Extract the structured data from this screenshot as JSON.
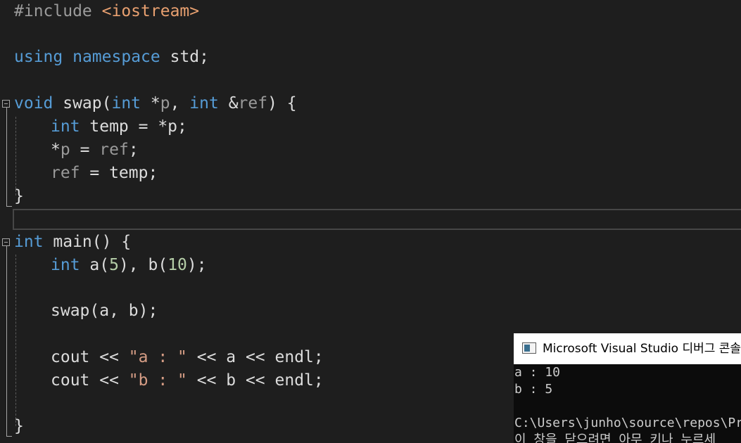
{
  "editor": {
    "lines": [
      {
        "kind": "include",
        "directive": "#include",
        "target": "<iostream>"
      },
      {
        "kind": "using",
        "kw1": "using",
        "kw2": "namespace",
        "rest": "std;"
      },
      {
        "kind": "swap-sig",
        "t_void": "void",
        "name": " swap(",
        "t_int1": "int",
        "star": " *",
        "p": "p",
        ",": ", ",
        "t_int2": "int",
        "amp": " &",
        "ref": "ref",
        "end": ") {"
      },
      {
        "kind": "decl",
        "t": "int",
        "rest": " temp = *p;"
      },
      {
        "kind": "assign1",
        "star": "*",
        "p": "p",
        "eq": " = ",
        "ref": "ref",
        "semi": ";"
      },
      {
        "kind": "assign2",
        "ref": "ref",
        "rest": " = temp;"
      },
      {
        "kind": "close",
        "text": "}"
      },
      {
        "kind": "main-sig",
        "t": "int",
        "rest": " main() {"
      },
      {
        "kind": "decl2",
        "t": "int",
        "a": " a(",
        "n1": "5",
        "mid": "), b(",
        "n2": "10",
        "end": ");"
      },
      {
        "kind": "call",
        "text": "swap(a, b);"
      },
      {
        "kind": "cout1",
        "pre": "cout << ",
        "str": "\"a : \"",
        "post": " << a << endl;"
      },
      {
        "kind": "cout2",
        "pre": "cout << ",
        "str": "\"b : \"",
        "post": " << b << endl;"
      },
      {
        "kind": "close2",
        "text": "}"
      }
    ]
  },
  "console": {
    "title": "Microsoft Visual Studio 디버그 콘솔",
    "output": [
      "a : 10",
      "b : 5",
      "",
      "C:\\Users\\junho\\source\\repos\\Proje",
      "이 창을 닫으려면 아무 키나 누르세"
    ]
  },
  "colors": {
    "background": "#1e1e1e",
    "keyword": "#569cd6",
    "include_target": "#e8a070",
    "string": "#d69d85",
    "number": "#b5cea8",
    "parameter": "#9a9a9a"
  }
}
